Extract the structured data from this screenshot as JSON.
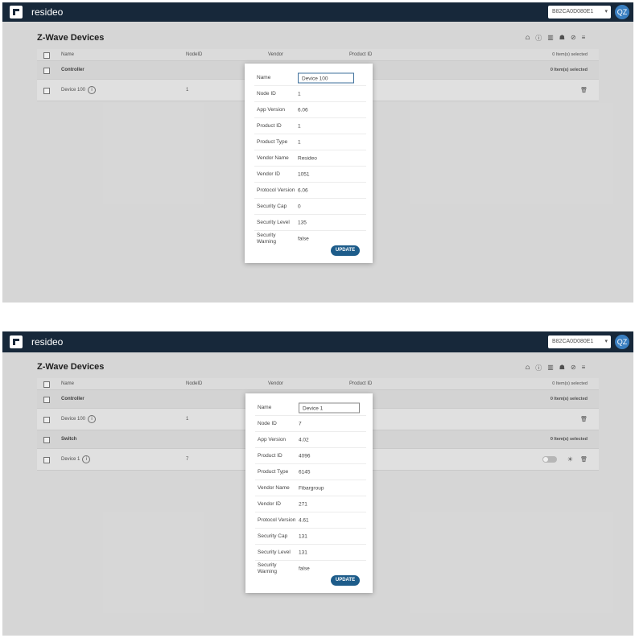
{
  "app": {
    "brand": "resideo",
    "device_select": "B82CA0D080E1",
    "avatar": "QZ",
    "page_title": "Z-Wave Devices"
  },
  "toolbar_icons": [
    "graph-icon",
    "info-icon",
    "bar-chart-icon",
    "cap-icon",
    "block-icon",
    "sort-icon"
  ],
  "table": {
    "columns": [
      "Name",
      "NodeID",
      "Vendor",
      "Product ID"
    ],
    "selected_text": "0 Item(s) selected"
  },
  "screen1": {
    "groups": [
      {
        "label": "Controller",
        "selected": "0 Item(s) selected"
      }
    ],
    "devices": [
      {
        "name": "Device 100",
        "node": "1"
      }
    ],
    "dialog": {
      "name_label": "Name",
      "name_value": "Device 100",
      "fields": [
        {
          "label": "Node ID",
          "value": "1"
        },
        {
          "label": "App Version",
          "value": "6.06"
        },
        {
          "label": "Product ID",
          "value": "1"
        },
        {
          "label": "Product Type",
          "value": "1"
        },
        {
          "label": "Vendor Name",
          "value": "Resideo"
        },
        {
          "label": "Vendor ID",
          "value": "1051"
        },
        {
          "label": "Protocol Version",
          "value": "6.06"
        },
        {
          "label": "Security Cap",
          "value": "0"
        },
        {
          "label": "Security Level",
          "value": "135"
        },
        {
          "label": "Security Warning",
          "value": "false"
        }
      ],
      "button": "UPDATE"
    }
  },
  "screen2": {
    "groups": [
      {
        "label": "Controller",
        "selected": "0 Item(s) selected"
      },
      {
        "label": "Switch",
        "selected": "0 Item(s) selected"
      }
    ],
    "devices": [
      {
        "name": "Device 100",
        "node": "1"
      },
      {
        "name": "Device 1",
        "node": "7"
      }
    ],
    "dialog": {
      "name_label": "Name",
      "name_value": "Device 1",
      "fields": [
        {
          "label": "Node ID",
          "value": "7"
        },
        {
          "label": "App Version",
          "value": "4.02"
        },
        {
          "label": "Product ID",
          "value": "4096"
        },
        {
          "label": "Product Type",
          "value": "6145"
        },
        {
          "label": "Vendor Name",
          "value": "Fibargroup"
        },
        {
          "label": "Vendor ID",
          "value": "271"
        },
        {
          "label": "Protocol Version",
          "value": "4.61"
        },
        {
          "label": "Security Cap",
          "value": "131"
        },
        {
          "label": "Security Level",
          "value": "131"
        },
        {
          "label": "Security Warning",
          "value": "false"
        }
      ],
      "button": "UPDATE"
    }
  },
  "colors": {
    "topbar": "#17283a",
    "accent": "#1d5c8a",
    "avatar": "#3a7fc1"
  }
}
